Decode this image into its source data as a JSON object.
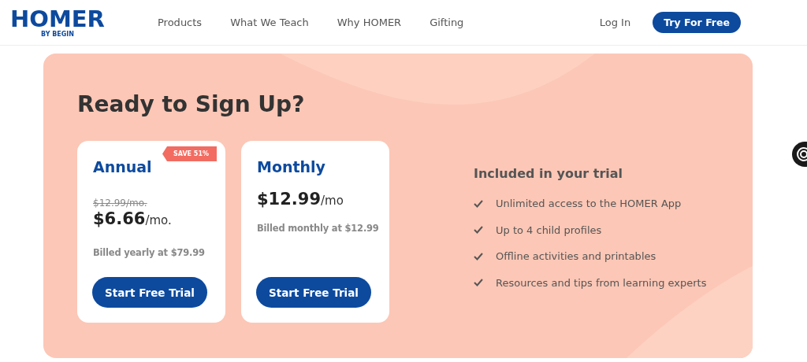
{
  "header": {
    "logo": {
      "name": "HOMER",
      "byline": "BY BEGIN"
    },
    "nav": [
      {
        "label": "Products"
      },
      {
        "label": "What We Teach"
      },
      {
        "label": "Why HOMER"
      },
      {
        "label": "Gifting"
      }
    ],
    "login": "Log In",
    "cta": "Try For Free"
  },
  "signup": {
    "title": "Ready to Sign Up?",
    "plans": [
      {
        "name": "Annual",
        "badge": "SAVE 51%",
        "old_price": "$12.99/mo.",
        "price": "$6.66",
        "unit": "/mo.",
        "billing": "Billed yearly at $79.99",
        "button": "Start Free Trial"
      },
      {
        "name": "Monthly",
        "price": "$12.99",
        "unit": "/mo",
        "billing": "Billed monthly at $12.99",
        "button": "Start Free Trial"
      }
    ],
    "included": {
      "title": "Included in your trial",
      "items": [
        "Unlimited access to the HOMER App",
        "Up to 4 child profiles",
        "Offline activities and printables",
        "Resources and tips from learning experts"
      ]
    }
  }
}
